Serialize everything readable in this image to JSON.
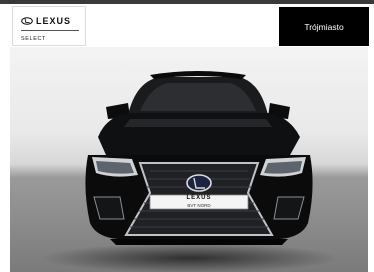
{
  "header": {
    "logo": {
      "brand": "LEXUS",
      "sub": "SELECT",
      "icon": "lexus-emblem-icon"
    },
    "location": "Trójmiasto"
  },
  "car": {
    "grille_badge": "LEXUS",
    "plate": "BVT NORD",
    "body_color": "#0b0b0c"
  },
  "colors": {
    "badge_bg": "#000000",
    "badge_text": "#ffffff",
    "top_bar": "#3a3a3a"
  }
}
